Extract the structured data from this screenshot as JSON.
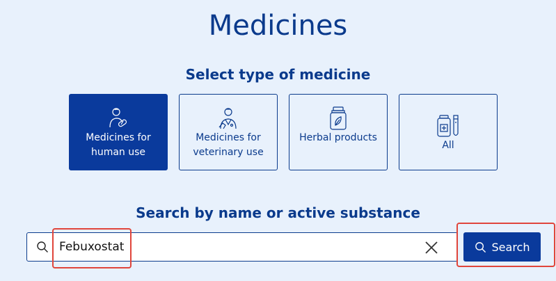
{
  "header": {
    "title": "Medicines",
    "subtitle": "Select type of medicine"
  },
  "types": [
    {
      "label": "Medicines for human use",
      "icon": "human-medicine-icon",
      "active": true
    },
    {
      "label": "Medicines for veterinary use",
      "icon": "veterinary-icon",
      "active": false
    },
    {
      "label": "Herbal products",
      "icon": "herbal-product-icon",
      "active": false
    },
    {
      "label": "All",
      "icon": "all-medicines-icon",
      "active": false
    }
  ],
  "search": {
    "heading": "Search by name or active substance",
    "value": "Febuxostat",
    "button_label": "Search"
  },
  "colors": {
    "background": "#e8f1fc",
    "primary": "#0a3a9c",
    "highlight": "#e0453b"
  }
}
